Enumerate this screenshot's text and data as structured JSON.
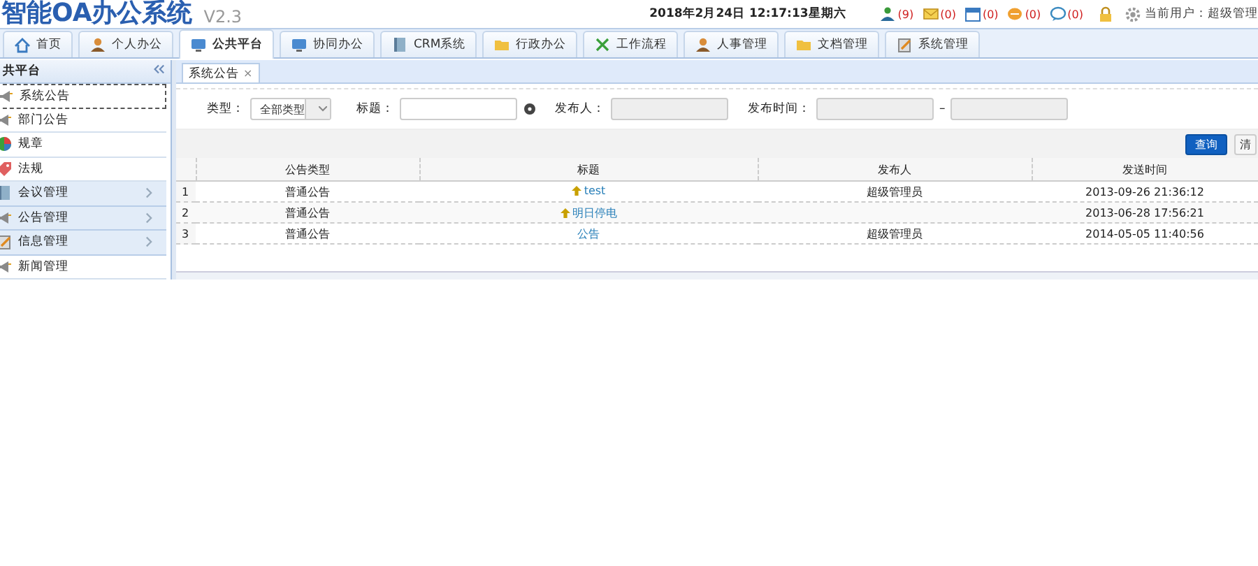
{
  "header": {
    "title": "智能OA办公系统",
    "version": "V2.3",
    "datetime": "2018年2月24日 12:17:13星期六",
    "counters": [
      {
        "kind": "user",
        "count": "(9)"
      },
      {
        "kind": "mail",
        "count": "(0)"
      },
      {
        "kind": "calendar",
        "count": "(0)"
      },
      {
        "kind": "chat",
        "count": "(0)"
      },
      {
        "kind": "bubble",
        "count": "(0)"
      }
    ],
    "current_user": "当前用户：超级管理"
  },
  "nav_tabs": [
    {
      "label": "首页",
      "selected": false
    },
    {
      "label": "个人办公",
      "selected": false
    },
    {
      "label": "公共平台",
      "selected": true
    },
    {
      "label": "协同办公",
      "selected": false
    },
    {
      "label": "CRM系统",
      "selected": false
    },
    {
      "label": "行政办公",
      "selected": false
    },
    {
      "label": "工作流程",
      "selected": false
    },
    {
      "label": "人事管理",
      "selected": false
    },
    {
      "label": "文档管理",
      "selected": false
    },
    {
      "label": "系统管理",
      "selected": false
    }
  ],
  "sidebar": {
    "title": "共平台",
    "items": [
      {
        "label": "系统公告",
        "kind": "item",
        "selected": true
      },
      {
        "label": "部门公告",
        "kind": "item",
        "selected": false
      },
      {
        "label": "规章",
        "kind": "item",
        "selected": false
      },
      {
        "label": "法规",
        "kind": "item",
        "selected": false
      },
      {
        "label": "会议管理",
        "kind": "group",
        "selected": false
      },
      {
        "label": "公告管理",
        "kind": "group",
        "selected": false
      },
      {
        "label": "信息管理",
        "kind": "group",
        "selected": false
      },
      {
        "label": "新闻管理",
        "kind": "item",
        "selected": false
      }
    ]
  },
  "content": {
    "tab": {
      "label": "系统公告",
      "close": "×"
    },
    "filters": {
      "type_label": "类型：",
      "type_value": "全部类型",
      "title_label": "标题：",
      "publisher_label": "发布人：",
      "time_label": "发布时间：",
      "time_separator": "–"
    },
    "buttons": [
      {
        "label": "查询",
        "kind": "primary"
      },
      {
        "label": "清",
        "kind": "plain"
      }
    ],
    "table": {
      "columns": [
        "公告类型",
        "标题",
        "发布人",
        "发送时间"
      ],
      "rows": [
        {
          "number": "1",
          "type": "普通公告",
          "title": "test",
          "pinned": true,
          "publisher": "超级管理员",
          "time": "2013-09-26 21:36:12"
        },
        {
          "number": "2",
          "type": "普通公告",
          "title": "明日停电",
          "pinned": true,
          "publisher": "",
          "time": "2013-06-28 17:56:21"
        },
        {
          "number": "3",
          "type": "普通公告",
          "title": "公告",
          "pinned": false,
          "publisher": "超级管理员",
          "time": "2014-05-05 11:40:56"
        }
      ]
    }
  }
}
